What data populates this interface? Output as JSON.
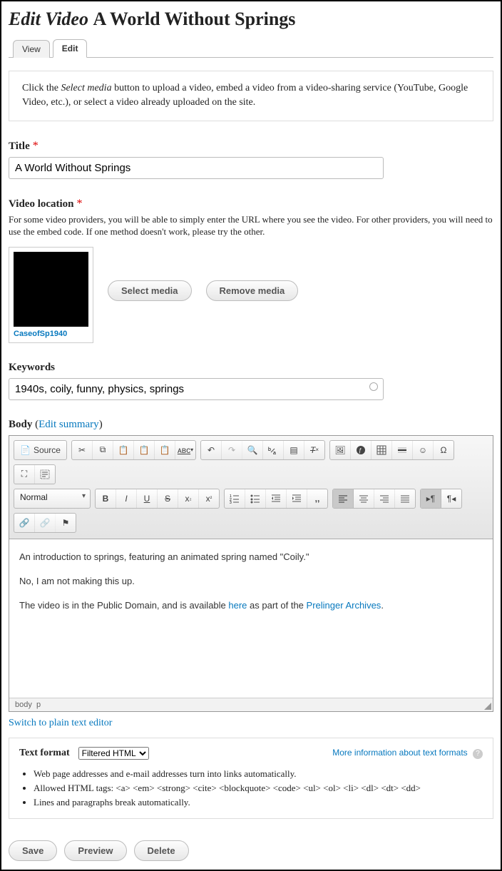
{
  "heading": {
    "prefix": "Edit Video",
    "title": "A World Without Springs"
  },
  "tabs": {
    "view": "View",
    "edit": "Edit"
  },
  "intro": {
    "before": "Click the ",
    "em": "Select media",
    "after": " button to upload a video, embed a video from a video-sharing service (YouTube, Google Video, etc.), or select a video already uploaded on the site."
  },
  "title_field": {
    "label": "Title",
    "value": "A World Without Springs"
  },
  "video_location": {
    "label": "Video location",
    "help": "For some video providers, you will be able to simply enter the URL where you see the video. For other providers, you will need to use the embed code. If one method doesn't work, please try the other.",
    "thumb_caption": "CaseofSp1940",
    "select_btn": "Select media",
    "remove_btn": "Remove media"
  },
  "keywords": {
    "label": "Keywords",
    "value": "1940s, coily, funny, physics, springs"
  },
  "body_field": {
    "label": "Body",
    "edit_summary": "Edit summary",
    "source_btn": "Source",
    "style_select": "Normal",
    "content_p1": "An introduction to springs, featuring an animated spring named \"Coily.\"",
    "content_p2": "No, I am not making this up.",
    "content_p3a": "The video is in the Public Domain, and is available ",
    "content_p3_link1": "here",
    "content_p3b": " as part of the ",
    "content_p3_link2": "Prelinger Archives",
    "content_p3c": ".",
    "path": "body  p",
    "switch_link": "Switch to plain text editor"
  },
  "format": {
    "label": "Text format",
    "selected": "Filtered HTML",
    "more_info": "More information about text formats",
    "tips": [
      "Web page addresses and e-mail addresses turn into links automatically.",
      "Allowed HTML tags: <a> <em> <strong> <cite> <blockquote> <code> <ul> <ol> <li> <dl> <dt> <dd>",
      "Lines and paragraphs break automatically."
    ]
  },
  "actions": {
    "save": "Save",
    "preview": "Preview",
    "delete": "Delete"
  }
}
